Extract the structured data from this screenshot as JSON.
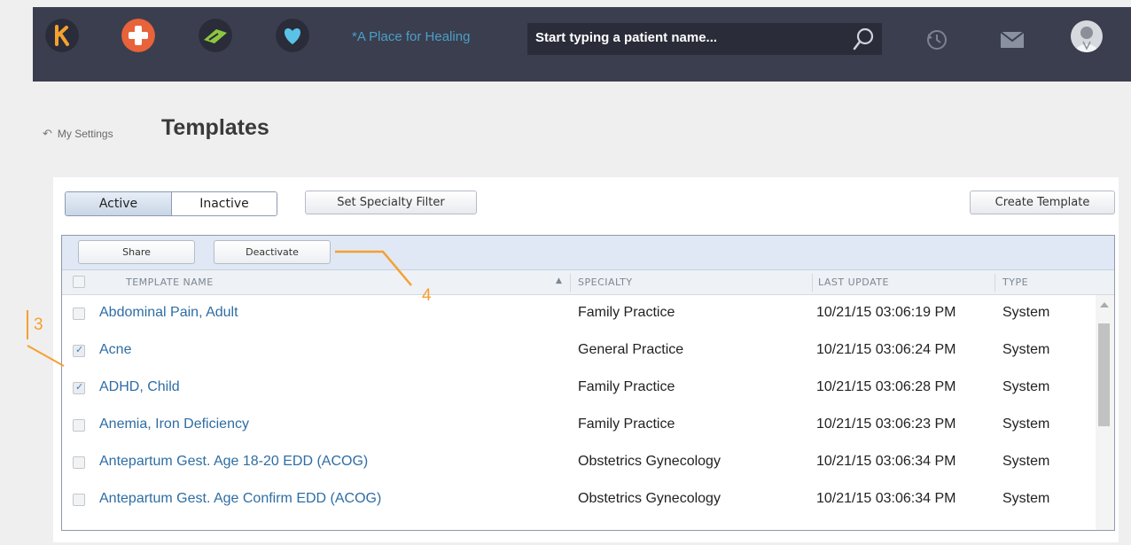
{
  "topbar": {
    "tagline": "*A Place for Healing",
    "search_placeholder": "Start typing a patient name...",
    "apps": [
      "kareo-logo-icon",
      "medical-cross-icon",
      "billing-icon",
      "heart-icon"
    ]
  },
  "header": {
    "back_label": "My Settings",
    "title": "Templates"
  },
  "filters": {
    "active_label": "Active",
    "inactive_label": "Inactive",
    "specialty_filter_label": "Set Specialty Filter",
    "create_label": "Create Template"
  },
  "toolbar": {
    "share_label": "Share",
    "deactivate_label": "Deactivate"
  },
  "columns": {
    "name": "TEMPLATE NAME",
    "specialty": "SPECIALTY",
    "last_update": "LAST UPDATE",
    "type": "TYPE"
  },
  "rows": [
    {
      "name": "Abdominal Pain, Adult",
      "specialty": "Family Practice",
      "last_update": "10/21/15 03:06:19 PM",
      "type": "System",
      "checked": false
    },
    {
      "name": "Acne",
      "specialty": "General Practice",
      "last_update": "10/21/15 03:06:24 PM",
      "type": "System",
      "checked": true
    },
    {
      "name": "ADHD, Child",
      "specialty": "Family Practice",
      "last_update": "10/21/15 03:06:28 PM",
      "type": "System",
      "checked": true
    },
    {
      "name": "Anemia, Iron Deficiency",
      "specialty": "Family Practice",
      "last_update": "10/21/15 03:06:23 PM",
      "type": "System",
      "checked": false
    },
    {
      "name": "Antepartum Gest. Age 18-20 EDD (ACOG)",
      "specialty": "Obstetrics Gynecology",
      "last_update": "10/21/15 03:06:34 PM",
      "type": "System",
      "checked": false
    },
    {
      "name": "Antepartum Gest. Age Confirm EDD (ACOG)",
      "specialty": "Obstetrics Gynecology",
      "last_update": "10/21/15 03:06:34 PM",
      "type": "System",
      "checked": false
    }
  ],
  "annotations": {
    "callout_3": "3",
    "callout_4": "4"
  },
  "colors": {
    "topbar": "#3b3e4e",
    "link": "#2e6da4",
    "annotation": "#f5a030"
  }
}
